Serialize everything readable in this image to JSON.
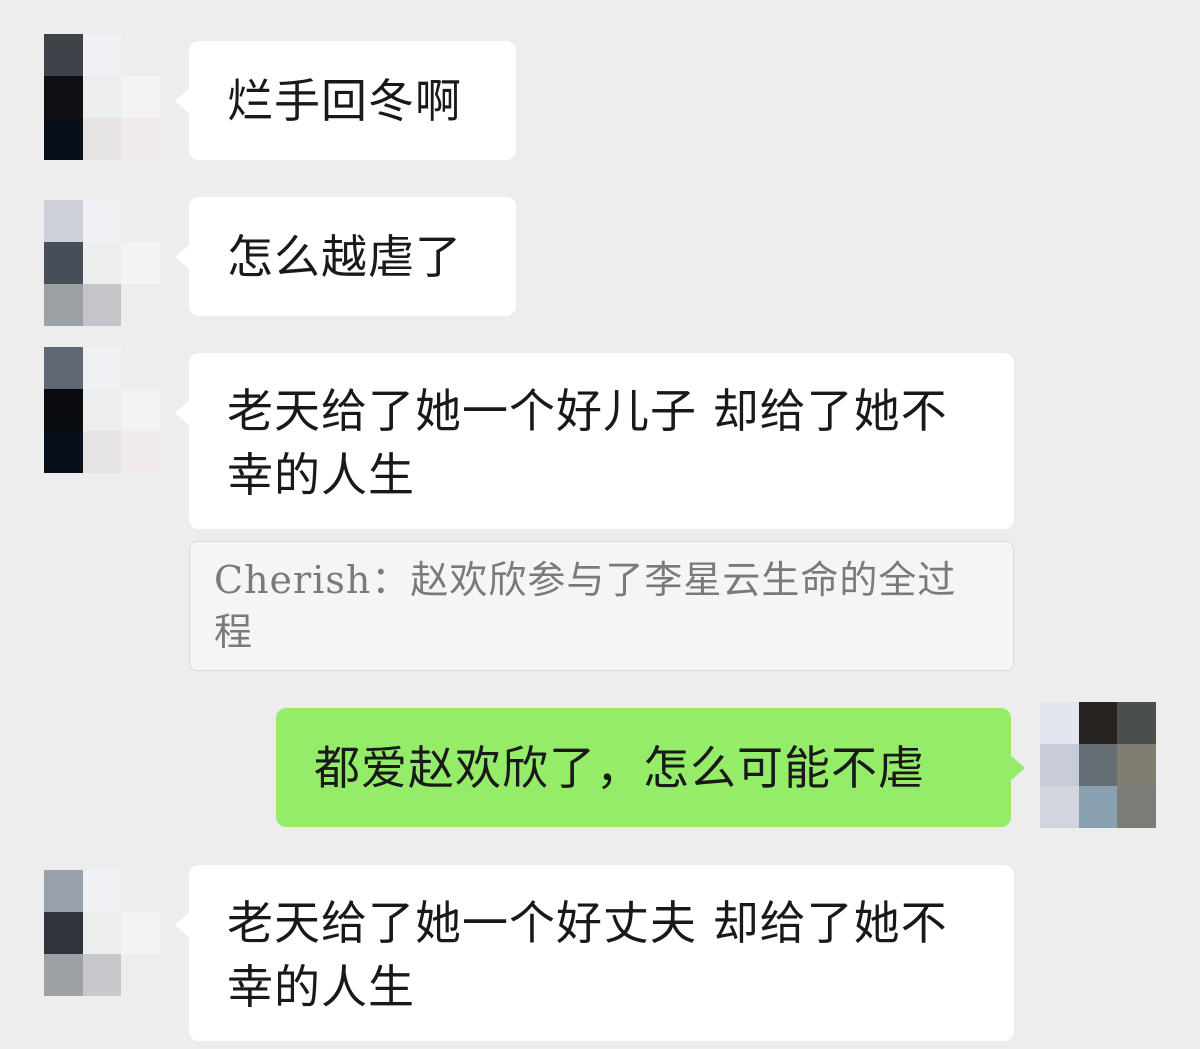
{
  "messages": [
    {
      "sender": "other",
      "text": "烂手回冬啊"
    },
    {
      "sender": "other",
      "text": "怎么越虐了"
    },
    {
      "sender": "other",
      "text": "老天给了她一个好儿子  却给了她不幸的人生"
    },
    {
      "sender": "me",
      "text": "都爱赵欢欣了，怎么可能不虐"
    },
    {
      "sender": "other",
      "text": "老天给了她一个好丈夫  却给了她不幸的人生"
    }
  ],
  "quote": {
    "author": "Cherish",
    "text": "Cherish：赵欢欣参与了李星云生命的全过程"
  },
  "colors": {
    "background": "#ededed",
    "incoming_bubble": "#ffffff",
    "outgoing_bubble": "#95ec69",
    "quote_bg": "#f5f5f5",
    "quote_text": "#7a7a7a"
  },
  "avatars": {
    "avatar_1": [
      "#3f4249",
      "#f0f1f5",
      "#ededed",
      "#0e0f13",
      "#eceeee",
      "#f4f3f2",
      "#080f18",
      "#e6e3e5",
      "#f1eaea"
    ],
    "avatar_2": [
      "#cdd0d9",
      "#f0f1f5",
      "#ededed",
      "#474e57",
      "#eceeee",
      "#f4f3f2",
      "#9ba1a2",
      "#c4c4c9",
      "#ededed"
    ],
    "avatar_3": [
      "#626873",
      "#f0f1f5",
      "#ededed",
      "#0a0b10",
      "#eceeee",
      "#f4f3f2",
      "#07101a",
      "#e6e3e5",
      "#f1eaea"
    ],
    "avatar_me": [
      "#e3e6ee",
      "#252220",
      "#4a4e4c",
      "#c8cbd8",
      "#656e74",
      "#7e7d70",
      "#d2d5de",
      "#89a0b0",
      "#7a7c77"
    ],
    "avatar_5": [
      "#98a0a9",
      "#f0f1f5",
      "#ededed",
      "#2e333c",
      "#eceeee",
      "#f4f3f2",
      "#9ea1a3",
      "#c7c8cb",
      "#ededed"
    ]
  }
}
